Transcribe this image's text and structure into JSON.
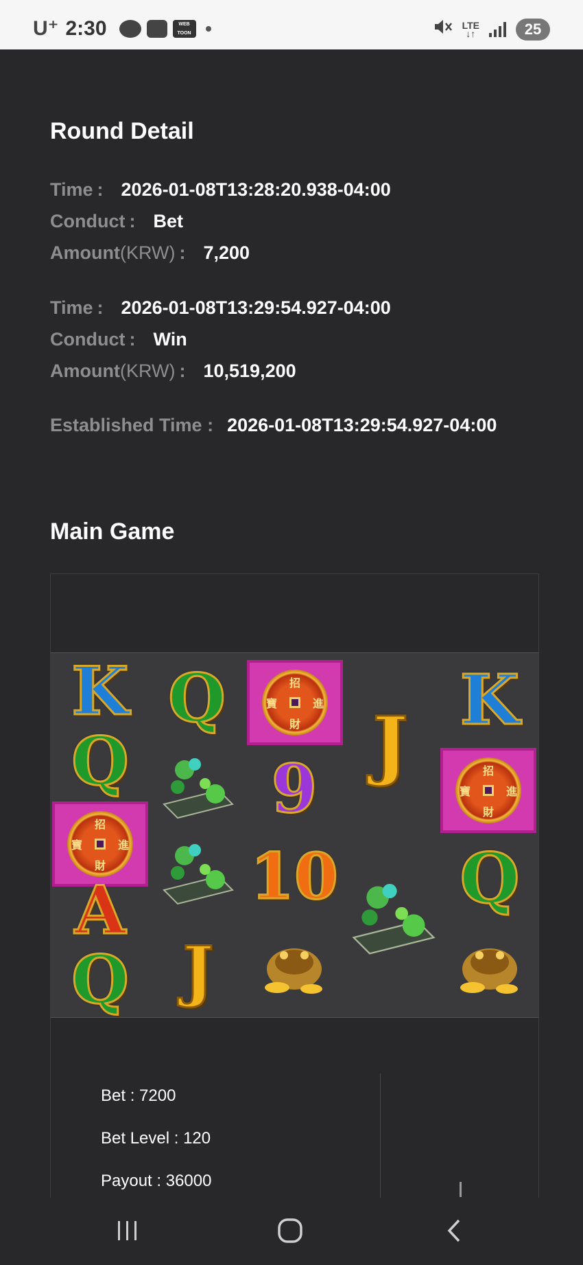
{
  "status_bar": {
    "carrier": "U⁺",
    "time": "2:30",
    "network": "LTE",
    "battery": "25"
  },
  "round_detail": {
    "title": "Round Detail",
    "entries": [
      {
        "time_label": "Time",
        "time": "2026-01-08T13:28:20.938-04:00",
        "conduct_label": "Conduct",
        "conduct": "Bet",
        "amount_label": "Amount",
        "amount_unit": "(KRW)",
        "amount": "7,200"
      },
      {
        "time_label": "Time",
        "time": "2026-01-08T13:29:54.927-04:00",
        "conduct_label": "Conduct",
        "conduct": "Win",
        "amount_label": "Amount",
        "amount_unit": "(KRW)",
        "amount": "10,519,200"
      }
    ],
    "established_label": "Established Time :",
    "established_time": "2026-01-08T13:29:54.927-04:00"
  },
  "main_game": {
    "title": "Main Game",
    "reels": [
      [
        "K",
        "Q",
        "coin",
        "A",
        "Q"
      ],
      [
        "Q",
        "jade",
        "jade",
        "J"
      ],
      [
        "coin",
        "9",
        "10",
        "toad"
      ],
      [
        "J",
        "jade"
      ],
      [
        "K",
        "coin",
        "Q",
        "toad"
      ]
    ],
    "bet": "Bet : 7200",
    "bet_level": "Bet Level : 120",
    "payout": "Payout : 36000"
  },
  "colors": {
    "background": "#28272a",
    "label": "#8e8e92",
    "value": "#ffffff",
    "reel_bg": "#3a3a3c"
  }
}
